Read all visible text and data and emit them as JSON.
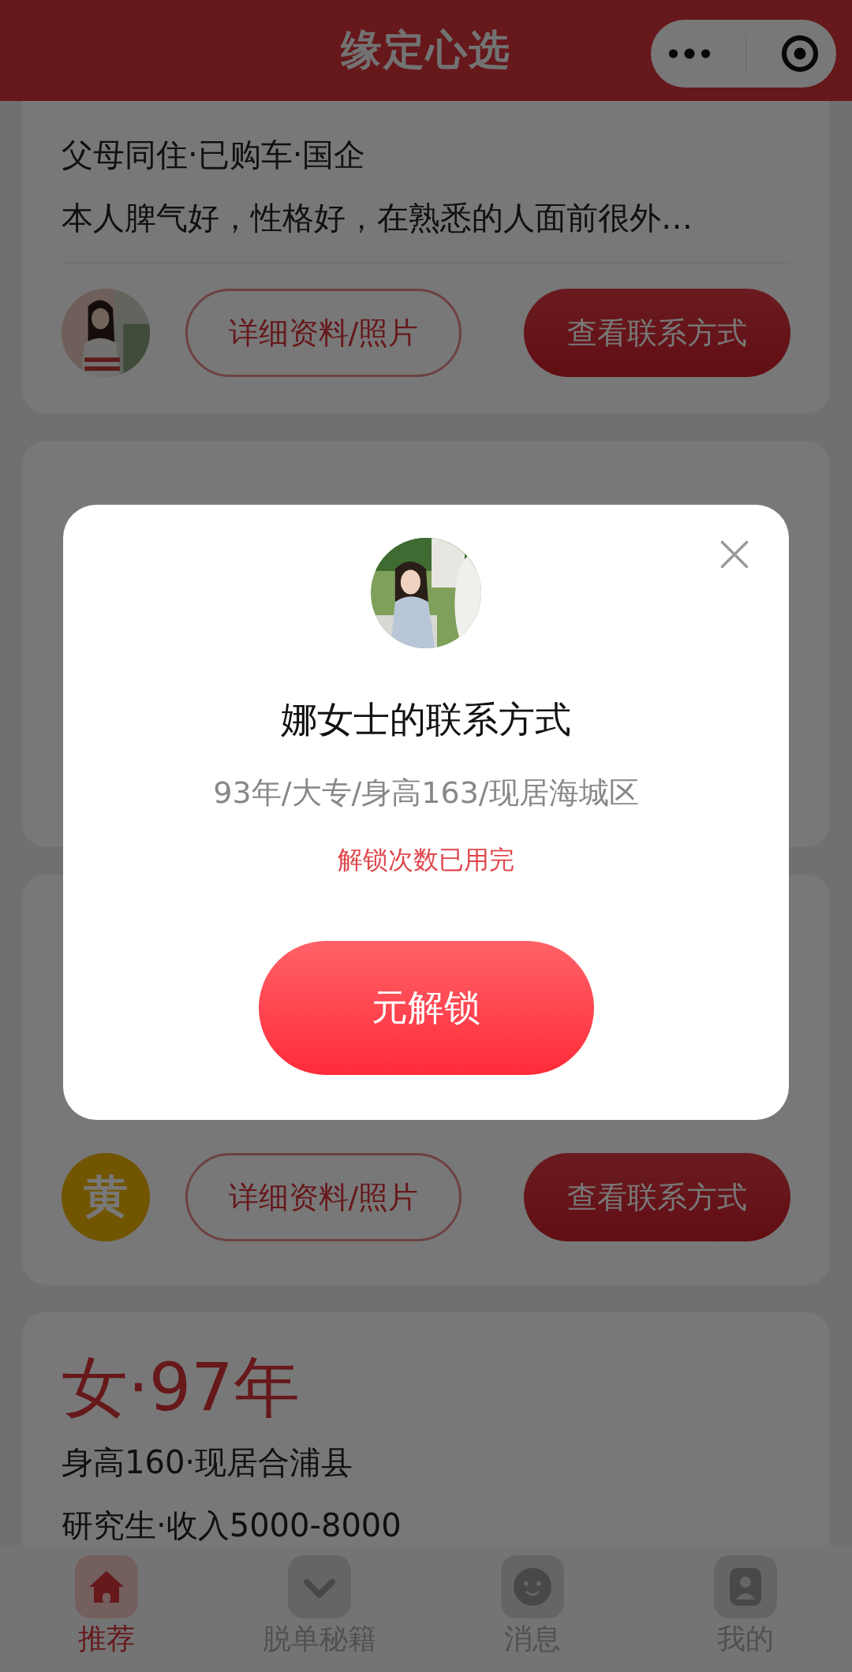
{
  "header": {
    "title": "缘定心选"
  },
  "cards": [
    {
      "lines": [
        "父母同住·已购车·国企",
        "本人脾气好，性格好，在熟悉的人面前很外…"
      ],
      "actions": {
        "avatar": {
          "kind": "picture"
        },
        "buttons": [
          "详细资料/照片",
          "查看联系方式"
        ]
      }
    },
    {
      "actions": {
        "avatar": {
          "kind": "initial",
          "text": "黄"
        },
        "buttons": [
          "详细资料/照片",
          "查看联系方式"
        ]
      }
    },
    {
      "title": "女·97年",
      "lines": [
        "身高160·现居合浦县",
        "研究生·收入5000-8000"
      ]
    }
  ],
  "modal": {
    "avatar": {
      "kind": "picture"
    },
    "title": "娜女士的联系方式",
    "subtitle": "93年/大专/身高163/现居海城区",
    "notice": "解锁次数已用完",
    "button": "元解锁"
  },
  "tabs": [
    {
      "label": "推荐",
      "kind": "home",
      "selected": true
    },
    {
      "label": "脱单秘籍",
      "kind": "guide",
      "selected": false
    },
    {
      "label": "消息",
      "kind": "message",
      "selected": false
    },
    {
      "label": "我的",
      "kind": "profile",
      "selected": false
    }
  ]
}
